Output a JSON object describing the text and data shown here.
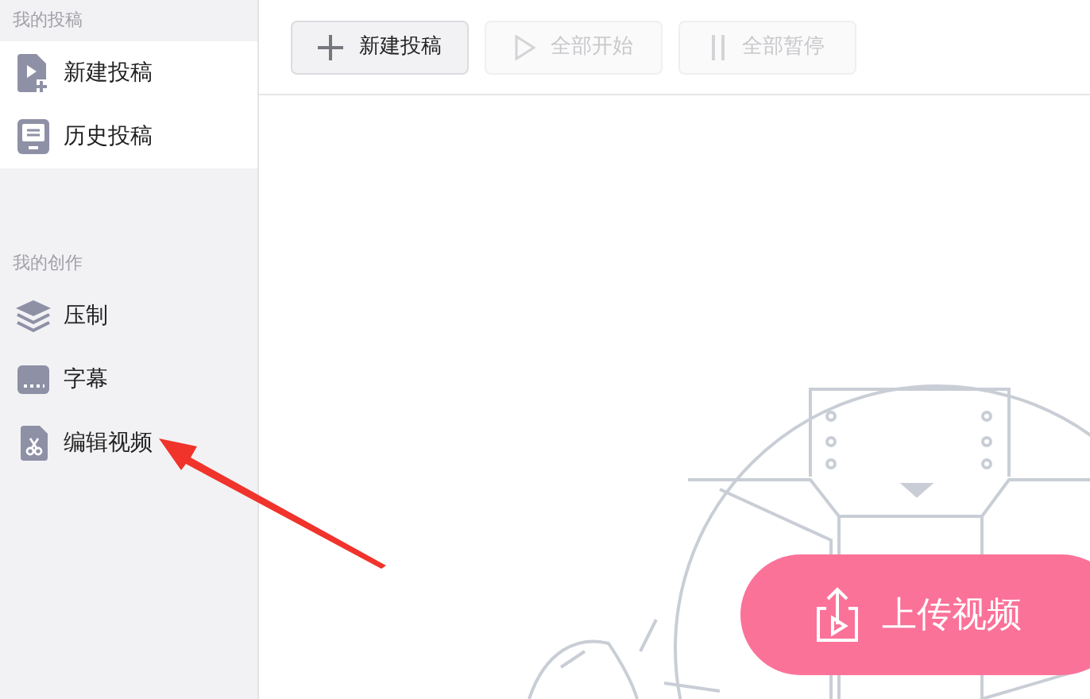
{
  "sidebar": {
    "sections": [
      {
        "title": "我的投稿",
        "items": [
          {
            "label": "新建投稿"
          },
          {
            "label": "历史投稿"
          }
        ]
      },
      {
        "title": "我的创作",
        "items": [
          {
            "label": "压制"
          },
          {
            "label": "字幕"
          },
          {
            "label": "编辑视频"
          }
        ]
      }
    ]
  },
  "toolbar": {
    "buttons": [
      {
        "label": "新建投稿",
        "disabled": false
      },
      {
        "label": "全部开始",
        "disabled": true
      },
      {
        "label": "全部暂停",
        "disabled": true
      }
    ]
  },
  "upload_button": {
    "label": "上传视频"
  }
}
